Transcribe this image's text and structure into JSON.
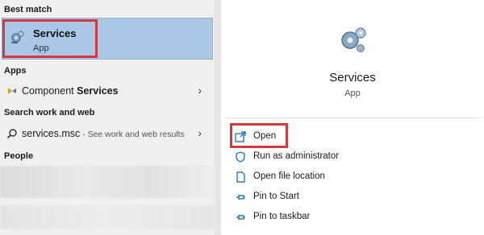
{
  "left": {
    "best_match_label": "Best match",
    "best_match": {
      "title": "Services",
      "subtitle": "App",
      "icon": "gears-icon"
    },
    "apps_label": "Apps",
    "apps": [
      {
        "text_prefix": "Component ",
        "text_bold": "Services",
        "icon": "component-services-icon"
      }
    ],
    "search_label": "Search work and web",
    "search_result": {
      "query": "services.msc",
      "hint": " - See work and web results",
      "icon": "search-icon"
    },
    "people_label": "People"
  },
  "right": {
    "app_title": "Services",
    "app_subtitle": "App",
    "app_icon": "gears-icon",
    "actions": [
      {
        "label": "Open",
        "icon": "open-icon"
      },
      {
        "label": "Run as administrator",
        "icon": "shield-icon"
      },
      {
        "label": "Open file location",
        "icon": "file-icon"
      },
      {
        "label": "Pin to Start",
        "icon": "pin-icon"
      },
      {
        "label": "Pin to taskbar",
        "icon": "pin-icon"
      }
    ]
  },
  "colors": {
    "selection": "#a9c8e8",
    "highlight_border": "#d6393b",
    "accent": "#0063b1"
  }
}
